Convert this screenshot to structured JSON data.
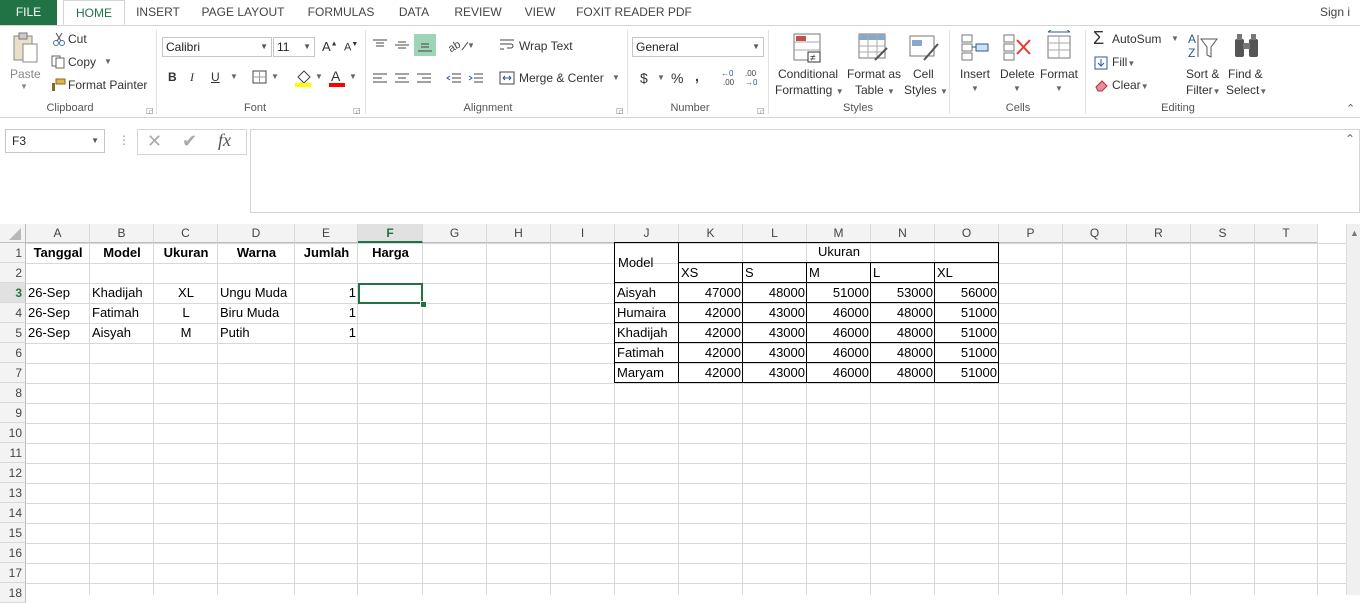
{
  "ribbon": {
    "tabs": [
      "FILE",
      "HOME",
      "INSERT",
      "PAGE LAYOUT",
      "FORMULAS",
      "DATA",
      "REVIEW",
      "VIEW",
      "FOXIT READER PDF"
    ],
    "active_tab": "HOME",
    "sign_in": "Sign i",
    "clipboard": {
      "paste": "Paste",
      "cut": "Cut",
      "copy": "Copy",
      "format_painter": "Format Painter",
      "label": "Clipboard"
    },
    "font": {
      "name": "Calibri",
      "size": "11",
      "bold": "B",
      "italic": "I",
      "underline": "U",
      "label": "Font"
    },
    "alignment": {
      "wrap_text": "Wrap Text",
      "merge_center": "Merge & Center",
      "label": "Alignment"
    },
    "number": {
      "format": "General",
      "currency": "$",
      "percent": "%",
      "comma": ",",
      "label": "Number"
    },
    "styles": {
      "conditional_l1": "Conditional",
      "conditional_l2": "Formatting",
      "format_table_l1": "Format as",
      "format_table_l2": "Table",
      "cell_styles_l1": "Cell",
      "cell_styles_l2": "Styles",
      "label": "Styles"
    },
    "cells": {
      "insert": "Insert",
      "delete": "Delete",
      "format": "Format",
      "label": "Cells"
    },
    "editing": {
      "autosum": "AutoSum",
      "fill": "Fill",
      "clear": "Clear",
      "sort_l1": "Sort &",
      "sort_l2": "Filter",
      "find_l1": "Find &",
      "find_l2": "Select",
      "label": "Editing"
    }
  },
  "formula_bar": {
    "name_box": "F3",
    "fx": "fx",
    "value": ""
  },
  "columns": [
    "A",
    "B",
    "C",
    "D",
    "E",
    "F",
    "G",
    "H",
    "I",
    "J",
    "K",
    "L",
    "M",
    "N",
    "O",
    "P",
    "Q",
    "R",
    "S",
    "T"
  ],
  "selected_column": "F",
  "rows": [
    "1",
    "2",
    "3",
    "4",
    "5",
    "6",
    "7",
    "8",
    "9",
    "10",
    "11",
    "12",
    "13",
    "14",
    "15",
    "16",
    "17",
    "18"
  ],
  "selected_row": "3",
  "left_table": {
    "headers": [
      "Tanggal",
      "Model",
      "Ukuran",
      "Warna",
      "Jumlah",
      "Harga"
    ],
    "rows": [
      [
        "26-Sep",
        "Khadijah",
        "XL",
        "Ungu Muda",
        "1",
        ""
      ],
      [
        "26-Sep",
        "Fatimah",
        "L",
        "Biru Muda",
        "1",
        ""
      ],
      [
        "26-Sep",
        "Aisyah",
        "M",
        "Putih",
        "1",
        ""
      ]
    ]
  },
  "price_table": {
    "model_header": "Model",
    "ukuran_header": "Ukuran",
    "sizes": [
      "XS",
      "S",
      "M",
      "L",
      "XL"
    ],
    "rows": [
      {
        "model": "Aisyah",
        "prices": [
          "47000",
          "48000",
          "51000",
          "53000",
          "56000"
        ]
      },
      {
        "model": "Humaira",
        "prices": [
          "42000",
          "43000",
          "46000",
          "48000",
          "51000"
        ]
      },
      {
        "model": "Khadijah",
        "prices": [
          "42000",
          "43000",
          "46000",
          "48000",
          "51000"
        ]
      },
      {
        "model": "Fatimah",
        "prices": [
          "42000",
          "43000",
          "46000",
          "48000",
          "51000"
        ]
      },
      {
        "model": "Maryam",
        "prices": [
          "42000",
          "43000",
          "46000",
          "48000",
          "51000"
        ]
      }
    ]
  },
  "colors": {
    "accent": "#217346",
    "grid": "#d8d8d8",
    "header_bg": "#f3f3f3"
  }
}
